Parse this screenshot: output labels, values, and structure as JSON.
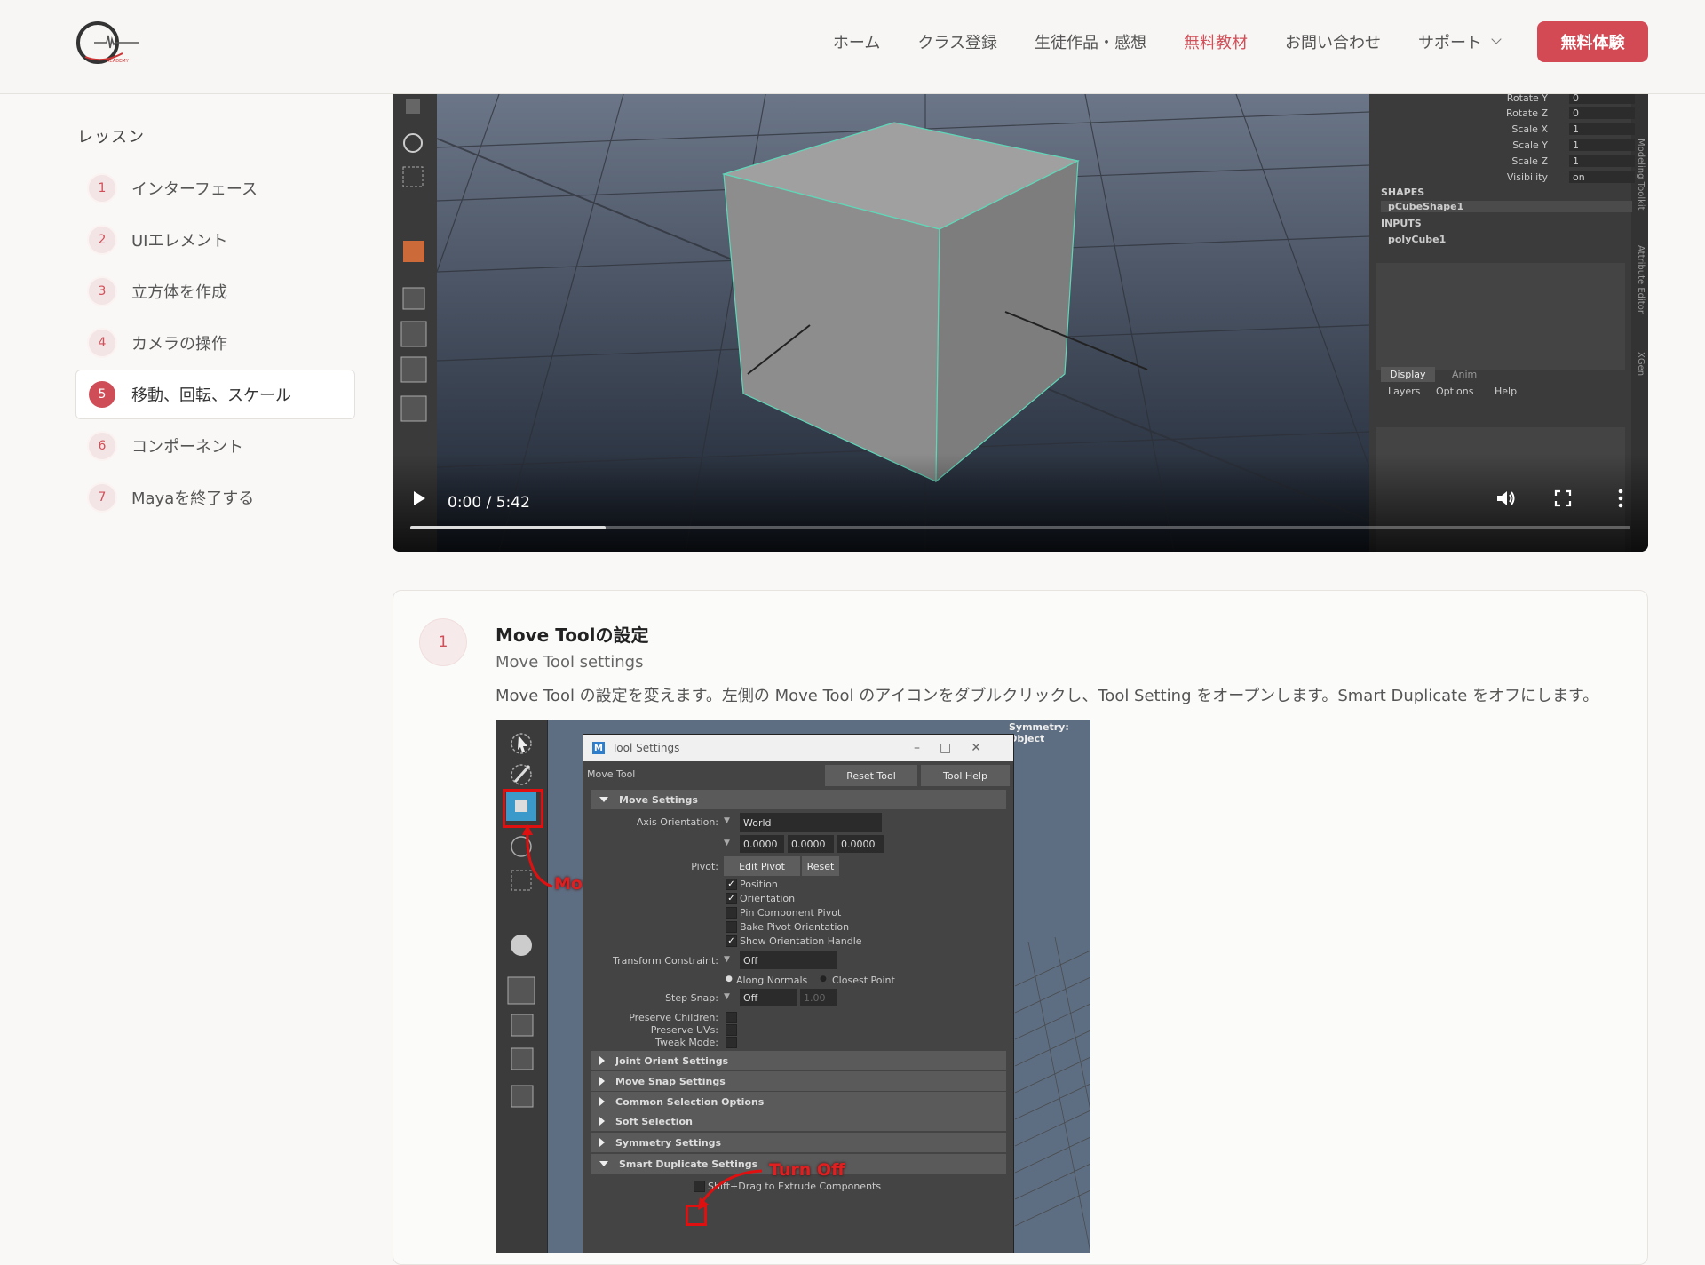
{
  "header": {
    "nav": [
      {
        "label": "ホーム",
        "active": false
      },
      {
        "label": "クラス登録",
        "active": false
      },
      {
        "label": "生徒作品・感想",
        "active": false
      },
      {
        "label": "無料教材",
        "active": true
      },
      {
        "label": "お問い合わせ",
        "active": false
      },
      {
        "label": "サポート",
        "active": false,
        "dropdown": true
      }
    ],
    "cta_label": "無料体験",
    "accent_color": "#d34a55"
  },
  "sidebar": {
    "title": "レッスン",
    "items": [
      {
        "num": "1",
        "label": "インターフェース"
      },
      {
        "num": "2",
        "label": "UIエレメント"
      },
      {
        "num": "3",
        "label": "立方体を作成"
      },
      {
        "num": "4",
        "label": "カメラの操作"
      },
      {
        "num": "5",
        "label": "移動、回転、スケール",
        "active": true
      },
      {
        "num": "6",
        "label": "コンポーネント"
      },
      {
        "num": "7",
        "label": "Mayaを終了する"
      }
    ]
  },
  "video": {
    "time": "0:00 / 5:42",
    "progress": 0.16,
    "channel_box": {
      "rows": [
        {
          "label": "Rotate Y",
          "value": "0"
        },
        {
          "label": "Rotate Z",
          "value": "0"
        },
        {
          "label": "Scale X",
          "value": "1"
        },
        {
          "label": "Scale Y",
          "value": "1"
        },
        {
          "label": "Scale Z",
          "value": "1"
        },
        {
          "label": "Visibility",
          "value": "on"
        }
      ],
      "shapes_label": "SHAPES",
      "shape_name": "pCubeShape1",
      "inputs_label": "INPUTS",
      "input_name": "polyCube1",
      "tabs": [
        "Display",
        "Anim"
      ],
      "menu": [
        "Layers",
        "Options",
        "Help"
      ],
      "side_tabs": [
        "Modeling Toolkit",
        "Attribute Editor",
        "XGen"
      ]
    }
  },
  "step": {
    "num": "1",
    "title": "Move Toolの設定",
    "subtitle": "Move Tool settings",
    "description": "Move Tool の設定を変えます。左側の Move Tool のアイコンをダブルクリックし、Tool Setting をオープンします。Smart Duplicate をオフにします。",
    "screenshot": {
      "symmetry": "Symmetry: Object",
      "window_title": "Tool Settings",
      "tool_name": "Move Tool",
      "reset_tool": "Reset Tool",
      "tool_help": "Tool Help",
      "move_settings": "Move Settings",
      "axis_orientation_label": "Axis Orientation:",
      "axis_orientation_value": "World",
      "axis_values": [
        "0.0000",
        "0.0000",
        "0.0000"
      ],
      "pivot_label": "Pivot:",
      "edit_pivot": "Edit Pivot",
      "reset": "Reset",
      "pivot_options": [
        {
          "label": "Position",
          "checked": true
        },
        {
          "label": "Orientation",
          "checked": true
        },
        {
          "label": "Pin Component Pivot",
          "checked": false
        },
        {
          "label": "Bake Pivot Orientation",
          "checked": false
        },
        {
          "label": "Show Orientation Handle",
          "checked": true
        }
      ],
      "transform_constraint_label": "Transform Constraint:",
      "transform_constraint_value": "Off",
      "along_normals": "Along Normals",
      "closest_point": "Closest Point",
      "step_snap_label": "Step Snap:",
      "step_snap_value": "Off",
      "step_snap_number": "1.00",
      "preserve_children": "Preserve Children:",
      "preserve_uvs": "Preserve UVs:",
      "tweak_mode": "Tweak Mode:",
      "sections": [
        {
          "label": "Joint Orient Settings",
          "open": false
        },
        {
          "label": "Move Snap Settings",
          "open": false
        },
        {
          "label": "Common Selection Options",
          "open": false
        },
        {
          "label": "Soft Selection",
          "open": false
        },
        {
          "label": "Symmetry Settings",
          "open": false
        },
        {
          "label": "Smart Duplicate Settings",
          "open": true
        }
      ],
      "shift_drag": "Shift+Drag to Extrude Components",
      "annotation_move_tool": "Move Tool",
      "annotation_turn_off": "Turn Off"
    }
  }
}
